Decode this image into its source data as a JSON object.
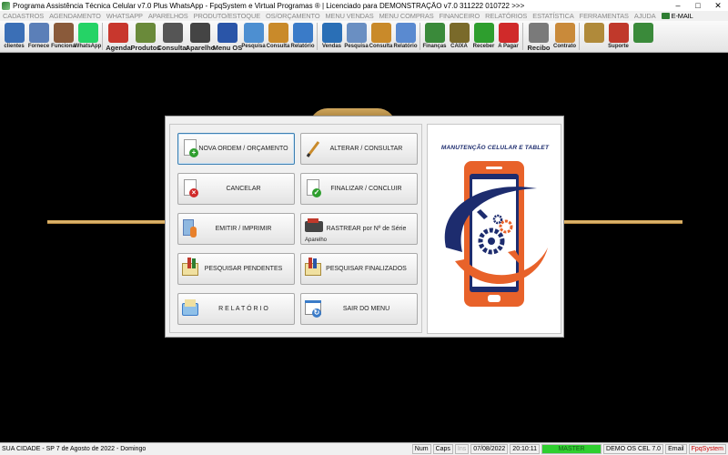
{
  "window": {
    "title": "Programa Assistência Técnica Celular v7.0 Plus WhatsApp - FpqSystem e Virtual Programas ® | Licenciado para  DEMONSTRAÇÃO v7.0 311222 010722 >>>",
    "minimize": "–",
    "maximize": "□",
    "close": "✕"
  },
  "menu": [
    "CADASTROS",
    "AGENDAMENTO",
    "WHATSAPP",
    "APARELHOS",
    "PRODUTO/ESTOQUE",
    "OS/ORÇAMENTO",
    "MENU VENDAS",
    "MENU COMPRAS",
    "FINANCEIRO",
    "RELATÓRIOS",
    "ESTATÍSTICA",
    "FERRAMENTAS",
    "AJUDA"
  ],
  "menu_email": "E-MAIL",
  "toolbar": [
    {
      "label": "clientes",
      "icon": "clients-icon",
      "color": "#3b6fb6"
    },
    {
      "label": "Fornece",
      "icon": "suppliers-icon",
      "color": "#5b7fb8"
    },
    {
      "label": "Funciona",
      "icon": "employees-icon",
      "color": "#8a5a3a"
    },
    {
      "label": "WhatsApp",
      "icon": "whatsapp-icon",
      "color": "#25d366",
      "sep": true
    },
    {
      "label": "Agenda",
      "icon": "calendar-icon",
      "color": "#c8372d",
      "big": true
    },
    {
      "label": "Produtos",
      "icon": "products-icon",
      "color": "#6a8a3a",
      "big": true
    },
    {
      "label": "Consultar",
      "icon": "search-products-icon",
      "color": "#555555",
      "big": true
    },
    {
      "label": "Aparelho",
      "icon": "device-icon",
      "color": "#444444",
      "big": true
    },
    {
      "label": "Menu OS",
      "icon": "os-menu-icon",
      "color": "#2a55a8",
      "big": true
    },
    {
      "label": "Pesquisa",
      "icon": "os-search-icon",
      "color": "#4d8fd1"
    },
    {
      "label": "Consulta",
      "icon": "os-consult-icon",
      "color": "#c98a2a"
    },
    {
      "label": "Relatório",
      "icon": "os-report-icon",
      "color": "#3a7bc8",
      "sep": true
    },
    {
      "label": "Vendas",
      "icon": "sales-icon",
      "color": "#2a6fb6"
    },
    {
      "label": "Pesquisa",
      "icon": "sales-search-icon",
      "color": "#6a8fc2"
    },
    {
      "label": "Consulta",
      "icon": "sales-consult-icon",
      "color": "#c98a2a"
    },
    {
      "label": "Relatório",
      "icon": "sales-report-icon",
      "color": "#5a8ad0",
      "sep": true
    },
    {
      "label": "Finanças",
      "icon": "finance-icon",
      "color": "#3a8a3a"
    },
    {
      "label": "CAIXA",
      "icon": "cashbox-icon",
      "color": "#7a6a2a"
    },
    {
      "label": "Receber",
      "icon": "receive-icon",
      "color": "#2e9e2e"
    },
    {
      "label": "A Pagar",
      "icon": "pay-icon",
      "color": "#d02a2a",
      "sep": true
    },
    {
      "label": "Recibo",
      "icon": "receipt-icon",
      "color": "#7a7a7a",
      "big": true
    },
    {
      "label": "Contrato",
      "icon": "contract-icon",
      "color": "#c98a3a",
      "sep": true
    },
    {
      "label": "",
      "icon": "coins-icon",
      "color": "#b08a3a"
    },
    {
      "label": "Suporte",
      "icon": "support-icon",
      "color": "#c0392b"
    },
    {
      "label": "",
      "icon": "exit-icon",
      "color": "#3a8a3a"
    }
  ],
  "dialog": {
    "buttons": [
      {
        "name": "new-order-button",
        "label": "NOVA ORDEM / ORÇAMENTO",
        "icon": "new-document-icon",
        "focused": true
      },
      {
        "name": "edit-consult-button",
        "label": "ALTERAR  /  CONSULTAR",
        "icon": "pencil-icon"
      },
      {
        "name": "cancel-button",
        "label": "CANCELAR",
        "icon": "cancel-document-icon"
      },
      {
        "name": "finalize-button",
        "label": "FINALIZAR  /  CONCLUIR",
        "icon": "check-document-icon"
      },
      {
        "name": "print-button",
        "label": "EMITIR  /  IMPRIMIR",
        "icon": "print-person-icon"
      },
      {
        "name": "track-serial-button",
        "label": "RASTREAR por Nº de Série",
        "icon": "device-icon",
        "sub": "Aparelho"
      },
      {
        "name": "search-pending-button",
        "label": "PESQUISAR PENDENTES",
        "icon": "pending-search-icon"
      },
      {
        "name": "search-finished-button",
        "label": "PESQUISAR FINALIZADOS",
        "icon": "finished-search-icon"
      },
      {
        "name": "report-button",
        "label": "R E L A T Ó R I O",
        "icon": "report-icon"
      },
      {
        "name": "exit-menu-button",
        "label": "SAIR DO MENU",
        "icon": "exit-window-icon"
      }
    ],
    "logo_title": "MANUTENÇÃO CELULAR E TABLET",
    "colors": {
      "phone_orange": "#e8622a",
      "phone_navy": "#1d2c6e",
      "gear_orange": "#e8622a"
    }
  },
  "status": {
    "city": "SUA CIDADE - SP  7 de Agosto de 2022 - Domingo",
    "num": "Num",
    "caps": "Caps",
    "ins": "Ins",
    "date": "07/08/2022",
    "time": "20:10:11",
    "user": "MASTER",
    "version": "DEMO OS CEL 7.0",
    "email": "Email",
    "brand": "FpqSystem"
  }
}
